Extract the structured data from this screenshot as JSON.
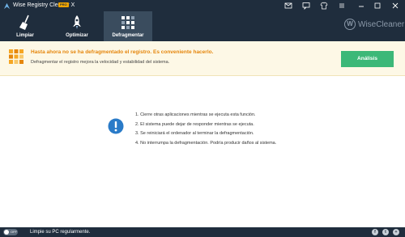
{
  "window": {
    "title": "Wise Registry Cleaner X",
    "badge": "PRO"
  },
  "toolbar": {
    "tabs": [
      {
        "label": "Limpiar",
        "icon": "broom-icon",
        "active": false
      },
      {
        "label": "Optimizar",
        "icon": "rocket-icon",
        "active": false
      },
      {
        "label": "Defragmentar",
        "icon": "defrag-blocks-icon",
        "active": true
      }
    ],
    "brand": "WiseCleaner",
    "brand_mark": "W"
  },
  "notice": {
    "title": "Hasta ahora no se ha defragmentado el registro. Es conveniente hacerlo.",
    "subtitle": "Defragmentar el registro mejora la velocidad y estabilidad del sistema.",
    "button_label": "Análisis",
    "accent_color": "#e5860c",
    "button_color": "#3cb878"
  },
  "tips": [
    "1. Cierre otras aplicaciones mientras se ejecuta esta función.",
    "2. El sistema puede dejar de responder mientras se ejecuta.",
    "3. Se reiniciará el ordenador al terminar la defragmentación.",
    "4. No interrumpa la defragmentación. Podría producir daños al sistema."
  ],
  "statusbar": {
    "toggle_label": "OFF",
    "text": "Limpie su PC regularmente.",
    "social": [
      "f",
      "t",
      "+"
    ]
  }
}
